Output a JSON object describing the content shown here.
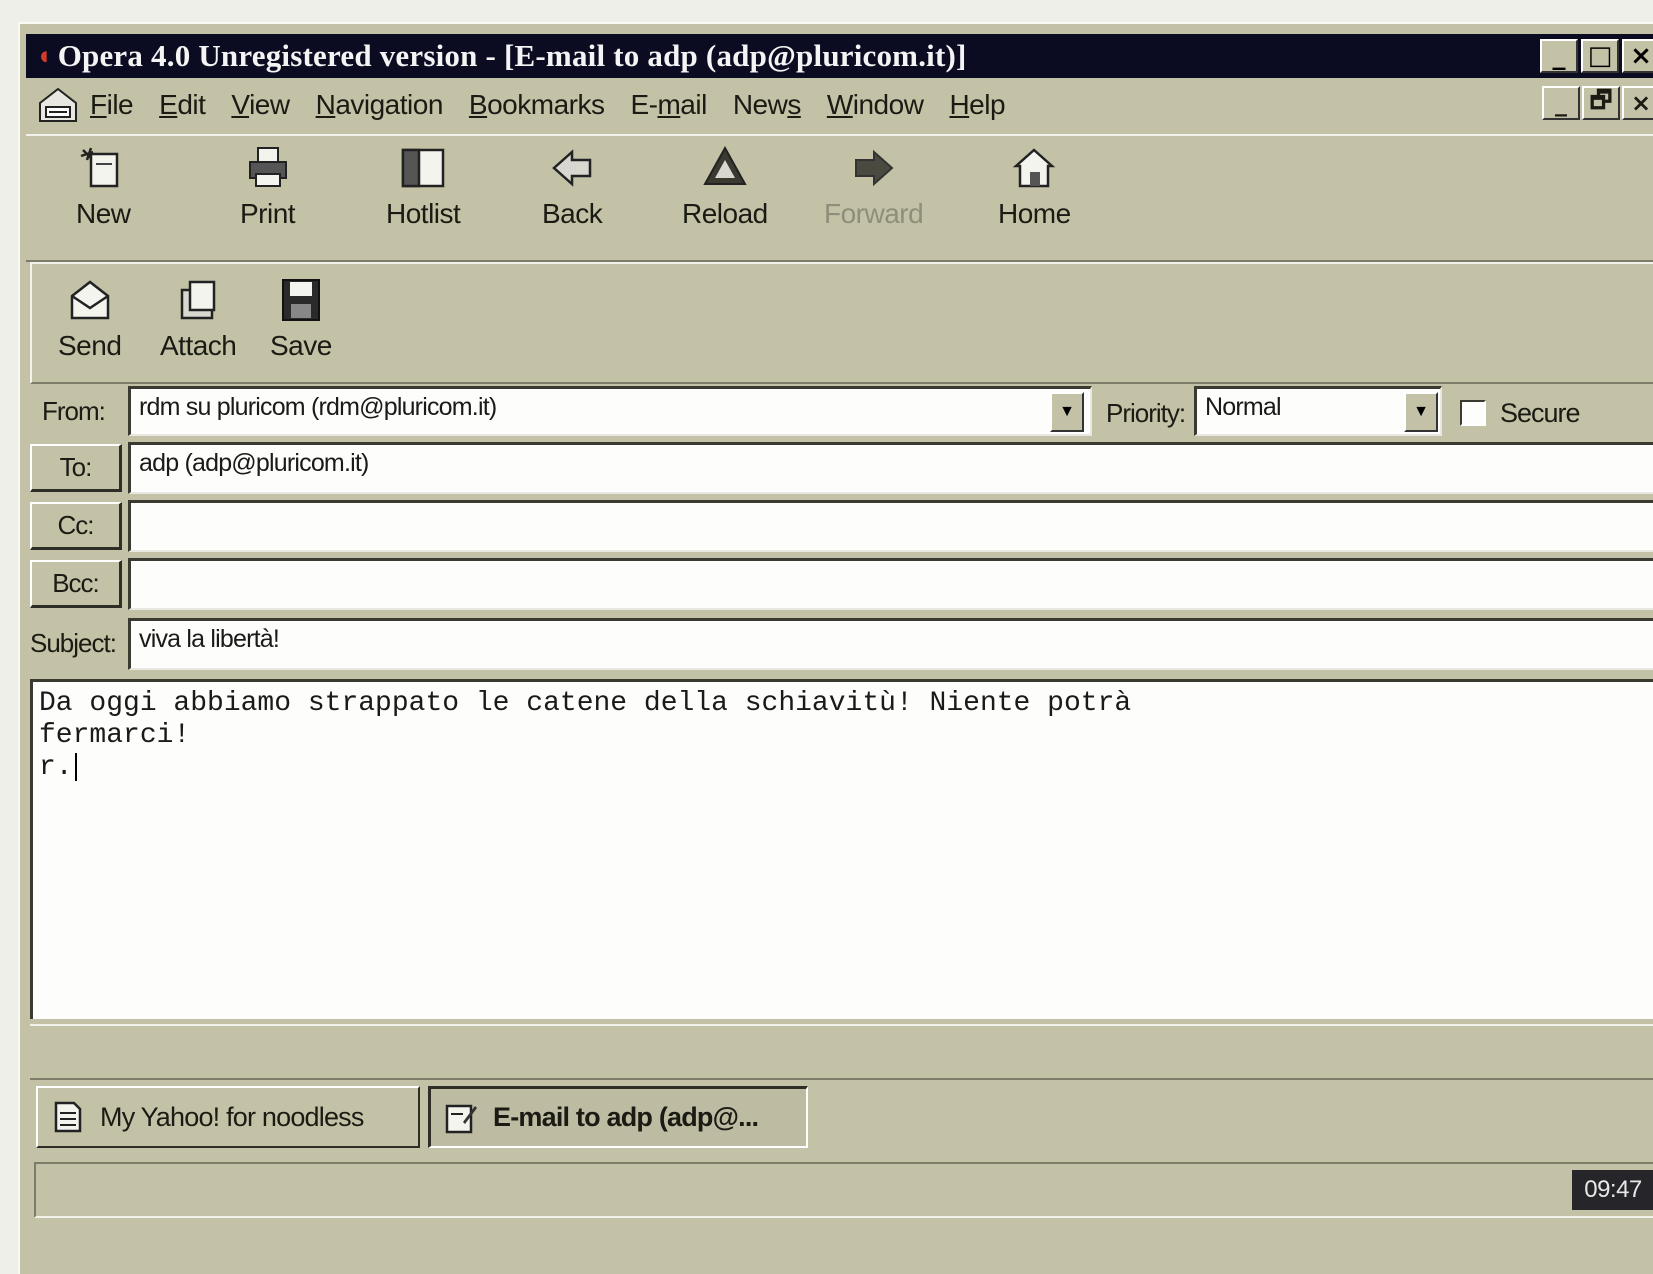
{
  "window": {
    "title": "Opera 4.0 Unregistered version - [E-mail to adp (adp@pluricom.it)]",
    "window_buttons": [
      "_",
      "□",
      "×"
    ],
    "mdi_buttons": [
      "_",
      "🗗",
      "×"
    ]
  },
  "menu": {
    "items": [
      {
        "pre": "",
        "u": "F",
        "post": "ile"
      },
      {
        "pre": "",
        "u": "E",
        "post": "dit"
      },
      {
        "pre": "",
        "u": "V",
        "post": "iew"
      },
      {
        "pre": "",
        "u": "N",
        "post": "avigation"
      },
      {
        "pre": "",
        "u": "B",
        "post": "ookmarks"
      },
      {
        "pre": "E-",
        "u": "m",
        "post": "ail"
      },
      {
        "pre": "New",
        "u": "s",
        "post": ""
      },
      {
        "pre": "",
        "u": "W",
        "post": "indow"
      },
      {
        "pre": "",
        "u": "H",
        "post": "elp"
      }
    ]
  },
  "toolbar": {
    "new": "New",
    "print": "Print",
    "hotlist": "Hotlist",
    "back": "Back",
    "reload": "Reload",
    "forward": "Forward",
    "home": "Home"
  },
  "mail_toolbar": {
    "send": "Send",
    "attach": "Attach",
    "save": "Save"
  },
  "compose": {
    "from_label": "From:",
    "from_value": "rdm su pluricom (rdm@pluricom.it)",
    "priority_label": "Priority:",
    "priority_value": "Normal",
    "secure_label": "Secure",
    "to_label": "To:",
    "to_value": "adp (adp@pluricom.it)",
    "cc_label": "Cc:",
    "cc_value": "",
    "bcc_label": "Bcc:",
    "bcc_value": "",
    "subject_label": "Subject:",
    "subject_value": "viva la libertà!",
    "body_lines": [
      "Da oggi abbiamo strappato le catene della schiavitù! Niente potrà",
      "fermarci!",
      "",
      "r."
    ]
  },
  "tabs": [
    {
      "label": "My Yahoo! for noodless",
      "active": false
    },
    {
      "label": "E-mail to adp (adp@...",
      "active": true
    }
  ],
  "status": {
    "clock": "09:47"
  }
}
